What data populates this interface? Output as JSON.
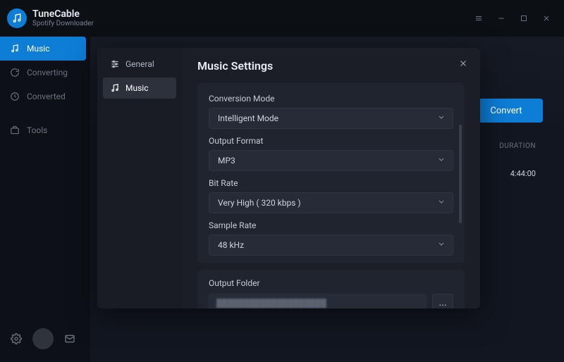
{
  "app": {
    "title": "TuneCable",
    "subtitle": "Spotify Downloader"
  },
  "sidebar": {
    "items": [
      {
        "label": "Music"
      },
      {
        "label": "Converting"
      },
      {
        "label": "Converted"
      },
      {
        "label": "Tools"
      }
    ]
  },
  "main": {
    "convert_label": "Convert",
    "header_duration": "DURATION",
    "value_duration": "4:44:00"
  },
  "settings": {
    "title": "Music Settings",
    "tabs": {
      "general": "General",
      "music": "Music"
    },
    "fields": {
      "conversion_mode": {
        "label": "Conversion Mode",
        "value": "Intelligent Mode"
      },
      "output_format": {
        "label": "Output Format",
        "value": "MP3"
      },
      "bit_rate": {
        "label": "Bit Rate",
        "value": "Very High ( 320 kbps )"
      },
      "sample_rate": {
        "label": "Sample Rate",
        "value": "48 kHz"
      },
      "output_folder": {
        "label": "Output Folder",
        "browse": "..."
      }
    }
  }
}
